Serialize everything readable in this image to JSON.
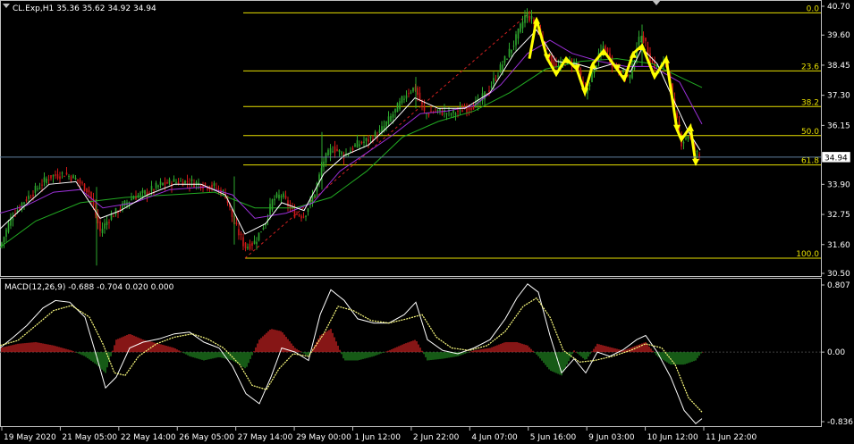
{
  "header": {
    "symbol_info": "CL.Exp,H1  35.36 35.62 34.92 34.94",
    "macd_info": "MACD(12,26,9) -0.688 -0.704 0.020 0.000"
  },
  "colors": {
    "background": "#000000",
    "bull": "#2ea82e",
    "bear": "#d01818",
    "ma_fast": "#ffffff",
    "ma_mid": "#9b30d8",
    "ma_slow": "#22aa22",
    "fib": "#e8e000",
    "zigzag": "#ffff00",
    "macd_line": "#ffffff",
    "signal_line": "#ffff80",
    "hist_pos": "#c02020",
    "hist_neg": "#208020",
    "price_line": "#6080a0",
    "grid_border": "#c0c0c0"
  },
  "chart_data": [
    {
      "type": "candlestick",
      "name": "price",
      "ylim": [
        30.5,
        40.7
      ],
      "y_ticks": [
        "40.70",
        "39.60",
        "38.45",
        "37.30",
        "36.15",
        "35.00",
        "33.90",
        "32.75",
        "31.60",
        "30.50"
      ],
      "x_ticks": [
        "19 May 2020",
        "21 May 05:00",
        "22 May 14:00",
        "26 May 05:00",
        "27 May 14:00",
        "29 May 00:00",
        "1 Jun 12:00",
        "2 Jun 22:00",
        "4 Jun 07:00",
        "5 Jun 16:00",
        "9 Jun 03:00",
        "10 Jun 12:00",
        "11 Jun 22:00"
      ],
      "current_price": "34.94",
      "path": [
        [
          0,
          31.5
        ],
        [
          12,
          32.6
        ],
        [
          25,
          33.2
        ],
        [
          40,
          33.7
        ],
        [
          55,
          34.2
        ],
        [
          72,
          34.3
        ],
        [
          85,
          34.1
        ],
        [
          100,
          33.6
        ],
        [
          112,
          32.1
        ],
        [
          122,
          32.6
        ],
        [
          135,
          33.0
        ],
        [
          148,
          33.4
        ],
        [
          165,
          33.6
        ],
        [
          180,
          33.9
        ],
        [
          195,
          34.0
        ],
        [
          210,
          34.0
        ],
        [
          225,
          33.9
        ],
        [
          240,
          33.8
        ],
        [
          252,
          33.5
        ],
        [
          262,
          32.4
        ],
        [
          274,
          31.5
        ],
        [
          285,
          31.7
        ],
        [
          297,
          32.5
        ],
        [
          305,
          33.3
        ],
        [
          315,
          33.5
        ],
        [
          328,
          32.8
        ],
        [
          340,
          32.7
        ],
        [
          352,
          33.6
        ],
        [
          362,
          34.8
        ],
        [
          372,
          35.3
        ],
        [
          385,
          35.0
        ],
        [
          398,
          35.4
        ],
        [
          412,
          35.6
        ],
        [
          425,
          35.9
        ],
        [
          440,
          36.6
        ],
        [
          455,
          37.4
        ],
        [
          464,
          37.6
        ],
        [
          475,
          36.6
        ],
        [
          490,
          36.7
        ],
        [
          505,
          36.6
        ],
        [
          520,
          36.8
        ],
        [
          535,
          37.0
        ],
        [
          548,
          37.6
        ],
        [
          562,
          38.5
        ],
        [
          575,
          39.3
        ],
        [
          588,
          40.4
        ],
        [
          600,
          40.0
        ],
        [
          612,
          38.9
        ],
        [
          622,
          38.3
        ],
        [
          633,
          38.6
        ],
        [
          645,
          38.5
        ],
        [
          654,
          37.3
        ],
        [
          665,
          38.4
        ],
        [
          675,
          39.2
        ],
        [
          685,
          38.5
        ],
        [
          697,
          38.1
        ],
        [
          705,
          38.0
        ],
        [
          712,
          39.2
        ],
        [
          718,
          39.6
        ],
        [
          728,
          38.6
        ],
        [
          735,
          38.3
        ],
        [
          745,
          38.6
        ],
        [
          755,
          36.6
        ],
        [
          762,
          35.5
        ],
        [
          770,
          35.8
        ],
        [
          776,
          35.2
        ],
        [
          783,
          34.94
        ]
      ],
      "ma_fast": [
        [
          0,
          32.2
        ],
        [
          25,
          33.0
        ],
        [
          55,
          33.9
        ],
        [
          85,
          34.0
        ],
        [
          112,
          32.6
        ],
        [
          135,
          32.9
        ],
        [
          165,
          33.5
        ],
        [
          195,
          33.9
        ],
        [
          225,
          33.9
        ],
        [
          252,
          33.5
        ],
        [
          274,
          32.0
        ],
        [
          297,
          32.4
        ],
        [
          315,
          33.2
        ],
        [
          340,
          32.9
        ],
        [
          362,
          34.3
        ],
        [
          385,
          35.0
        ],
        [
          412,
          35.4
        ],
        [
          440,
          36.3
        ],
        [
          464,
          37.2
        ],
        [
          490,
          36.8
        ],
        [
          520,
          36.8
        ],
        [
          548,
          37.4
        ],
        [
          575,
          38.9
        ],
        [
          600,
          39.8
        ],
        [
          622,
          38.6
        ],
        [
          645,
          38.5
        ],
        [
          665,
          38.3
        ],
        [
          685,
          38.5
        ],
        [
          705,
          38.2
        ],
        [
          718,
          39.1
        ],
        [
          735,
          38.5
        ],
        [
          755,
          37.0
        ],
        [
          770,
          35.9
        ],
        [
          783,
          35.2
        ]
      ],
      "ma_mid": [
        [
          0,
          32.8
        ],
        [
          30,
          33.1
        ],
        [
          60,
          33.6
        ],
        [
          90,
          33.7
        ],
        [
          115,
          33.0
        ],
        [
          150,
          33.2
        ],
        [
          190,
          33.7
        ],
        [
          230,
          33.8
        ],
        [
          260,
          33.5
        ],
        [
          285,
          32.6
        ],
        [
          320,
          32.8
        ],
        [
          350,
          33.2
        ],
        [
          380,
          34.4
        ],
        [
          410,
          35.1
        ],
        [
          440,
          35.8
        ],
        [
          470,
          36.6
        ],
        [
          500,
          36.7
        ],
        [
          530,
          36.9
        ],
        [
          560,
          37.7
        ],
        [
          590,
          38.9
        ],
        [
          615,
          39.4
        ],
        [
          640,
          38.9
        ],
        [
          670,
          38.6
        ],
        [
          700,
          38.4
        ],
        [
          730,
          38.4
        ],
        [
          760,
          37.8
        ],
        [
          785,
          36.2
        ]
      ],
      "ma_slow": [
        [
          0,
          31.5
        ],
        [
          40,
          32.5
        ],
        [
          90,
          33.2
        ],
        [
          140,
          33.4
        ],
        [
          190,
          33.5
        ],
        [
          240,
          33.6
        ],
        [
          285,
          33.0
        ],
        [
          330,
          33.0
        ],
        [
          370,
          33.4
        ],
        [
          410,
          34.4
        ],
        [
          450,
          35.7
        ],
        [
          490,
          36.3
        ],
        [
          530,
          36.7
        ],
        [
          570,
          37.4
        ],
        [
          610,
          38.3
        ],
        [
          650,
          38.6
        ],
        [
          690,
          38.7
        ],
        [
          730,
          38.5
        ],
        [
          760,
          38.0
        ],
        [
          785,
          37.6
        ]
      ],
      "fibonacci": {
        "levels": [
          {
            "label": "0.0",
            "price": 40.45
          },
          {
            "label": "23.6",
            "price": 38.23
          },
          {
            "label": "38.2",
            "price": 36.87
          },
          {
            "label": "50.0",
            "price": 35.76
          },
          {
            "label": "61.8",
            "price": 34.64
          },
          {
            "label": "100.0",
            "price": 31.08
          }
        ],
        "trend_line": [
          [
            274,
            31.08
          ],
          [
            592,
            40.45
          ]
        ]
      },
      "zigzag": [
        [
          592,
          38.7
        ],
        [
          600,
          40.2
        ],
        [
          612,
          38.7
        ],
        [
          622,
          38.1
        ],
        [
          633,
          38.7
        ],
        [
          645,
          38.3
        ],
        [
          654,
          37.4
        ],
        [
          663,
          38.5
        ],
        [
          675,
          39.0
        ],
        [
          690,
          38.3
        ],
        [
          698,
          37.9
        ],
        [
          708,
          38.9
        ],
        [
          718,
          39.2
        ],
        [
          732,
          38.0
        ],
        [
          745,
          38.7
        ],
        [
          757,
          36.0
        ],
        [
          762,
          35.6
        ],
        [
          772,
          36.1
        ],
        [
          778,
          34.7
        ]
      ]
    },
    {
      "type": "macd",
      "name": "MACD(12,26,9)",
      "ylim": [
        -0.836,
        0.807
      ],
      "y_ticks": [
        "0.807",
        "0.00",
        "-0.836"
      ],
      "macd": [
        [
          0,
          0.05
        ],
        [
          15,
          0.18
        ],
        [
          30,
          0.32
        ],
        [
          48,
          0.53
        ],
        [
          62,
          0.62
        ],
        [
          78,
          0.6
        ],
        [
          95,
          0.42
        ],
        [
          108,
          -0.05
        ],
        [
          118,
          -0.43
        ],
        [
          130,
          -0.3
        ],
        [
          145,
          0.05
        ],
        [
          160,
          0.12
        ],
        [
          178,
          0.16
        ],
        [
          195,
          0.22
        ],
        [
          212,
          0.24
        ],
        [
          228,
          0.12
        ],
        [
          245,
          0.05
        ],
        [
          260,
          -0.17
        ],
        [
          275,
          -0.5
        ],
        [
          290,
          -0.62
        ],
        [
          303,
          -0.3
        ],
        [
          315,
          0.05
        ],
        [
          330,
          0.0
        ],
        [
          345,
          -0.1
        ],
        [
          358,
          0.45
        ],
        [
          370,
          0.75
        ],
        [
          385,
          0.62
        ],
        [
          400,
          0.4
        ],
        [
          418,
          0.35
        ],
        [
          435,
          0.35
        ],
        [
          452,
          0.45
        ],
        [
          465,
          0.6
        ],
        [
          478,
          0.15
        ],
        [
          495,
          0.02
        ],
        [
          512,
          -0.02
        ],
        [
          530,
          0.05
        ],
        [
          548,
          0.15
        ],
        [
          565,
          0.4
        ],
        [
          578,
          0.65
        ],
        [
          590,
          0.82
        ],
        [
          602,
          0.72
        ],
        [
          615,
          0.2
        ],
        [
          628,
          -0.25
        ],
        [
          642,
          -0.08
        ],
        [
          655,
          -0.25
        ],
        [
          668,
          0.0
        ],
        [
          682,
          -0.05
        ],
        [
          697,
          0.03
        ],
        [
          712,
          0.15
        ],
        [
          722,
          0.2
        ],
        [
          735,
          0.0
        ],
        [
          750,
          -0.3
        ],
        [
          765,
          -0.7
        ],
        [
          778,
          -0.86
        ],
        [
          785,
          -0.8
        ]
      ],
      "signal": [
        [
          0,
          0.08
        ],
        [
          20,
          0.14
        ],
        [
          40,
          0.32
        ],
        [
          60,
          0.5
        ],
        [
          80,
          0.56
        ],
        [
          100,
          0.42
        ],
        [
          115,
          0.1
        ],
        [
          128,
          -0.25
        ],
        [
          140,
          -0.28
        ],
        [
          155,
          -0.05
        ],
        [
          175,
          0.1
        ],
        [
          195,
          0.18
        ],
        [
          215,
          0.22
        ],
        [
          232,
          0.16
        ],
        [
          250,
          0.05
        ],
        [
          268,
          -0.15
        ],
        [
          282,
          -0.4
        ],
        [
          298,
          -0.45
        ],
        [
          312,
          -0.2
        ],
        [
          328,
          -0.02
        ],
        [
          345,
          -0.05
        ],
        [
          362,
          0.22
        ],
        [
          378,
          0.55
        ],
        [
          395,
          0.5
        ],
        [
          415,
          0.38
        ],
        [
          435,
          0.35
        ],
        [
          455,
          0.4
        ],
        [
          472,
          0.45
        ],
        [
          488,
          0.18
        ],
        [
          505,
          0.05
        ],
        [
          525,
          0.02
        ],
        [
          545,
          0.08
        ],
        [
          565,
          0.25
        ],
        [
          585,
          0.55
        ],
        [
          600,
          0.65
        ],
        [
          615,
          0.42
        ],
        [
          630,
          0.02
        ],
        [
          648,
          -0.12
        ],
        [
          665,
          -0.1
        ],
        [
          685,
          -0.05
        ],
        [
          705,
          0.02
        ],
        [
          722,
          0.1
        ],
        [
          740,
          0.05
        ],
        [
          755,
          -0.15
        ],
        [
          770,
          -0.55
        ],
        [
          785,
          -0.72
        ]
      ],
      "histogram": [
        [
          0,
          0.05
        ],
        [
          20,
          0.1
        ],
        [
          40,
          0.12
        ],
        [
          60,
          0.08
        ],
        [
          80,
          0.02
        ],
        [
          95,
          -0.05
        ],
        [
          108,
          -0.15
        ],
        [
          118,
          -0.25
        ],
        [
          130,
          0.15
        ],
        [
          145,
          0.22
        ],
        [
          160,
          0.15
        ],
        [
          178,
          0.1
        ],
        [
          195,
          0.05
        ],
        [
          212,
          -0.05
        ],
        [
          228,
          -0.1
        ],
        [
          245,
          -0.06
        ],
        [
          260,
          -0.1
        ],
        [
          275,
          -0.2
        ],
        [
          290,
          0.15
        ],
        [
          303,
          0.28
        ],
        [
          315,
          0.25
        ],
        [
          330,
          0.05
        ],
        [
          345,
          -0.05
        ],
        [
          358,
          0.2
        ],
        [
          370,
          0.28
        ],
        [
          385,
          -0.1
        ],
        [
          400,
          -0.1
        ],
        [
          418,
          -0.05
        ],
        [
          435,
          0.02
        ],
        [
          452,
          0.1
        ],
        [
          465,
          0.15
        ],
        [
          478,
          -0.1
        ],
        [
          495,
          -0.08
        ],
        [
          512,
          -0.05
        ],
        [
          530,
          0.02
        ],
        [
          548,
          0.05
        ],
        [
          565,
          0.12
        ],
        [
          578,
          0.12
        ],
        [
          590,
          0.08
        ],
        [
          602,
          -0.05
        ],
        [
          615,
          -0.22
        ],
        [
          628,
          -0.28
        ],
        [
          642,
          0.02
        ],
        [
          655,
          -0.1
        ],
        [
          668,
          0.1
        ],
        [
          682,
          0.06
        ],
        [
          697,
          0.02
        ],
        [
          712,
          0.08
        ],
        [
          722,
          0.12
        ],
        [
          735,
          -0.05
        ],
        [
          750,
          -0.15
        ],
        [
          765,
          -0.15
        ],
        [
          778,
          -0.1
        ],
        [
          785,
          0.0
        ]
      ]
    }
  ]
}
